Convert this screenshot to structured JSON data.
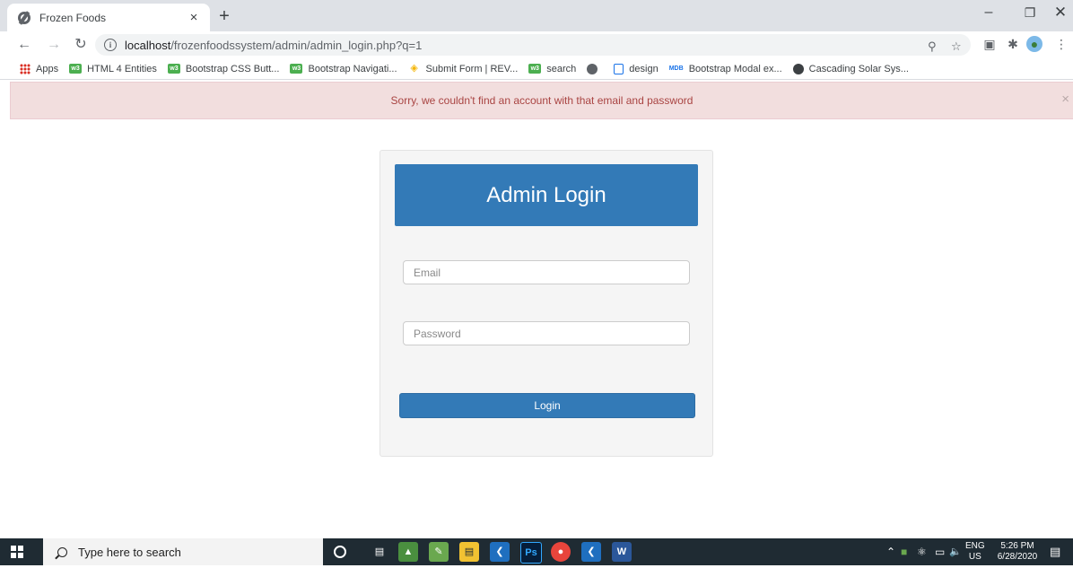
{
  "browser": {
    "tab_title": "Frozen Foods",
    "tab_close": "×",
    "new_tab": "+",
    "url_host": "localhost",
    "url_path": "/frozenfoodssystem/admin/admin_login.php?q=1",
    "window_min": "–",
    "window_restore": "❐",
    "window_close": "✕"
  },
  "bookmarks": [
    {
      "label": "Apps",
      "icon": "apps-grid-icon"
    },
    {
      "label": "HTML 4 Entities",
      "icon": "w3schools-icon"
    },
    {
      "label": "Bootstrap CSS Butt...",
      "icon": "w3schools-icon"
    },
    {
      "label": "Bootstrap Navigati...",
      "icon": "w3schools-icon"
    },
    {
      "label": "Submit Form | REV...",
      "icon": "rev-icon"
    },
    {
      "label": "search",
      "icon": "w3schools-icon"
    },
    {
      "label": "",
      "icon": "globe-icon"
    },
    {
      "label": "design",
      "icon": "design-icon"
    },
    {
      "label": "Bootstrap Modal ex...",
      "icon": "mdb-icon"
    },
    {
      "label": "Cascading Solar Sys...",
      "icon": "codepen-icon"
    }
  ],
  "alert": {
    "message": "Sorry, we couldn't find an account with that email and password",
    "close": "×"
  },
  "login": {
    "title": "Admin Login",
    "email_placeholder": "Email",
    "password_placeholder": "Password",
    "button_label": "Login"
  },
  "taskbar": {
    "search_placeholder": "Type here to search",
    "language": "ENG",
    "region": "US",
    "time": "5:26 PM",
    "date": "6/28/2020"
  },
  "colors": {
    "primary": "#337ab7",
    "alert_bg": "#f2dede",
    "alert_text": "#a94442",
    "panel_bg": "#f5f5f5",
    "taskbar": "#1f2b33"
  }
}
